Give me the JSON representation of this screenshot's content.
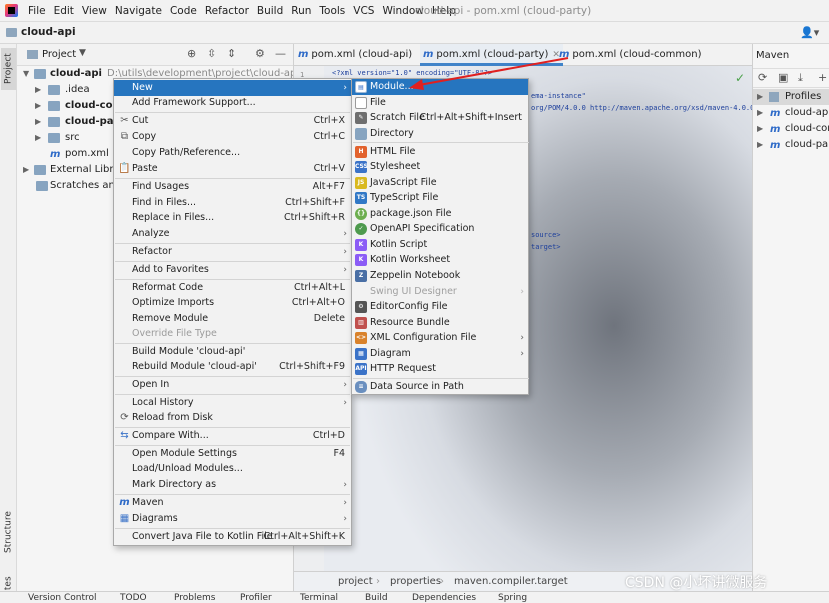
{
  "menubar": {
    "items": [
      "File",
      "Edit",
      "View",
      "Navigate",
      "Code",
      "Refactor",
      "Build",
      "Run",
      "Tools",
      "VCS",
      "Window",
      "Help"
    ],
    "window_title": "cloud-api - pom.xml (cloud-party)"
  },
  "navbar": {
    "project": "cloud-api"
  },
  "left_strip": {
    "project": "Project",
    "structure": "Structure",
    "favorites": "Favorites"
  },
  "project_panel": {
    "title": "Project",
    "tree": [
      {
        "label": "cloud-api",
        "path": "D:\\utils\\development\\project\\cloud-api"
      },
      {
        "label": ".idea"
      },
      {
        "label": "cloud-com"
      },
      {
        "label": "cloud-party"
      },
      {
        "label": "src"
      },
      {
        "label": "pom.xml"
      },
      {
        "label": "External Librari"
      },
      {
        "label": "Scratches and C"
      }
    ]
  },
  "editor": {
    "tabs": [
      "pom.xml (cloud-api)",
      "pom.xml (cloud-party)",
      "pom.xml (cloud-common)"
    ],
    "code": {
      "line1": "<?xml version=\"1.0\" encoding=\"UTF-8\"?>",
      "line_number": "1",
      "line2": "ema-instance\"",
      "line3": "org/POM/4.0.0 http://maven.apache.org/xsd/maven-4.0.0.x",
      "line4": "source>",
      "line5": "target>"
    },
    "breadcrumb": [
      "project",
      "properties",
      "maven.compiler.target"
    ]
  },
  "maven_panel": {
    "title": "Maven",
    "items": [
      "Profiles",
      "cloud-api",
      "cloud-com",
      "cloud-part"
    ]
  },
  "context_menu": {
    "items": [
      {
        "label": "New",
        "arrow": true,
        "selected": true
      },
      {
        "label": "Add Framework Support..."
      },
      {
        "label": "Cut",
        "shortcut": "Ctrl+X",
        "icon": "cut-icon"
      },
      {
        "label": "Copy",
        "shortcut": "Ctrl+C",
        "icon": "copy-icon"
      },
      {
        "label": "Copy Path/Reference..."
      },
      {
        "label": "Paste",
        "shortcut": "Ctrl+V",
        "icon": "paste-icon"
      },
      {
        "label": "Find Usages",
        "shortcut": "Alt+F7"
      },
      {
        "label": "Find in Files...",
        "shortcut": "Ctrl+Shift+F"
      },
      {
        "label": "Replace in Files...",
        "shortcut": "Ctrl+Shift+R"
      },
      {
        "label": "Analyze",
        "arrow": true
      },
      {
        "label": "Refactor",
        "arrow": true
      },
      {
        "label": "Add to Favorites",
        "arrow": true
      },
      {
        "label": "Reformat Code",
        "shortcut": "Ctrl+Alt+L"
      },
      {
        "label": "Optimize Imports",
        "shortcut": "Ctrl+Alt+O"
      },
      {
        "label": "Remove Module",
        "shortcut": "Delete"
      },
      {
        "label": "Override File Type",
        "disabled": true
      },
      {
        "label": "Build Module 'cloud-api'"
      },
      {
        "label": "Rebuild Module 'cloud-api'",
        "shortcut": "Ctrl+Shift+F9"
      },
      {
        "label": "Open In",
        "arrow": true
      },
      {
        "label": "Local History",
        "arrow": true
      },
      {
        "label": "Reload from Disk",
        "icon": "reload-icon"
      },
      {
        "label": "Compare With...",
        "shortcut": "Ctrl+D",
        "icon": "compare-icon"
      },
      {
        "label": "Open Module Settings",
        "shortcut": "F4"
      },
      {
        "label": "Load/Unload Modules..."
      },
      {
        "label": "Mark Directory as",
        "arrow": true
      },
      {
        "label": "Maven",
        "arrow": true,
        "icon": "maven-icon"
      },
      {
        "label": "Diagrams",
        "arrow": true,
        "icon": "diagram-icon"
      },
      {
        "label": "Convert Java File to Kotlin File",
        "shortcut": "Ctrl+Alt+Shift+K"
      }
    ]
  },
  "submenu": {
    "items": [
      {
        "label": "Module...",
        "selected": true,
        "icon": "module-icon",
        "color": "#2f6bc8"
      },
      {
        "label": "File",
        "icon": "file-icon",
        "color": "#ffffff"
      },
      {
        "label": "Scratch File",
        "shortcut": "Ctrl+Alt+Shift+Insert",
        "icon": "scratch-file-icon",
        "color": "#6e6e6e"
      },
      {
        "label": "Directory",
        "icon": "directory-icon",
        "color": "#87a4c0"
      },
      {
        "label": "HTML File",
        "icon": "html-file-icon",
        "color": "#e2622d"
      },
      {
        "label": "Stylesheet",
        "icon": "css-file-icon",
        "color": "#3b73c8"
      },
      {
        "label": "JavaScript File",
        "icon": "js-file-icon",
        "color": "#d9b91f"
      },
      {
        "label": "TypeScript File",
        "icon": "ts-file-icon",
        "color": "#3178c6"
      },
      {
        "label": "package.json File",
        "icon": "package-json-icon",
        "color": "#6cae4f"
      },
      {
        "label": "OpenAPI Specification",
        "icon": "openapi-icon",
        "color": "#4e9a4e"
      },
      {
        "label": "Kotlin Script",
        "icon": "kotlin-script-icon",
        "color": "#8b5cf6"
      },
      {
        "label": "Kotlin Worksheet",
        "icon": "kotlin-worksheet-icon",
        "color": "#8b5cf6"
      },
      {
        "label": "Zeppelin Notebook",
        "icon": "zeppelin-icon",
        "color": "#4a6fa5"
      },
      {
        "label": "Swing UI Designer",
        "arrow": true,
        "disabled": true
      },
      {
        "label": "EditorConfig File",
        "icon": "editorconfig-icon",
        "color": "#555555"
      },
      {
        "label": "Resource Bundle",
        "icon": "resource-bundle-icon",
        "color": "#c0504d"
      },
      {
        "label": "XML Configuration File",
        "arrow": true,
        "icon": "xml-config-icon",
        "color": "#d9822b"
      },
      {
        "label": "Diagram",
        "arrow": true,
        "icon": "diagram-icon",
        "color": "#3b73c8"
      },
      {
        "label": "HTTP Request",
        "icon": "http-request-icon",
        "color": "#3b73c8"
      },
      {
        "label": "Data Source in Path",
        "icon": "datasource-icon",
        "color": "#6a8fbf"
      }
    ]
  },
  "statusbar": {
    "items": [
      "Version Control",
      "TODO",
      "Problems",
      "Profiler",
      "Terminal",
      "Build",
      "Dependencies",
      "Spring"
    ]
  },
  "watermark": "CSDN @小坏讲微服务"
}
